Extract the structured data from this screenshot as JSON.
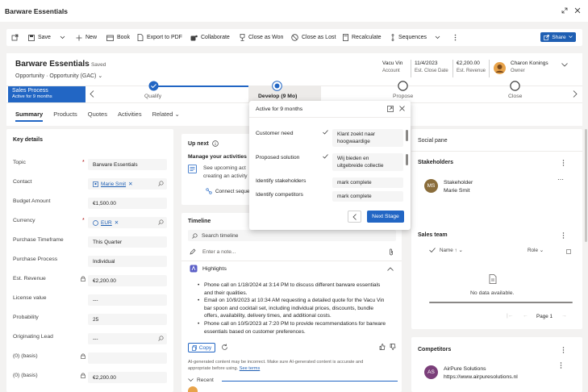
{
  "dialog": {
    "title": "Barware Essentials"
  },
  "toolbar": {
    "save": "Save",
    "new": "New",
    "book": "Book",
    "export_pdf": "Export to PDF",
    "collaborate": "Collaborate",
    "close_won": "Close as Won",
    "close_lost": "Close as Lost",
    "recalculate": "Recalculate",
    "sequences": "Sequences",
    "share": "Share"
  },
  "header": {
    "title": "Barware Essentials",
    "saved": "- Saved",
    "entity": "Opportunity",
    "form": "Opportunity (GAC)",
    "account_value": "Vacu Vin",
    "account_label": "Account",
    "close_date_value": "11/4/2023",
    "close_date_label": "Est. Close Date",
    "revenue_value": "€2,200.00",
    "revenue_label": "Est. Revenue",
    "owner_value": "Charon Konings",
    "owner_label": "Owner"
  },
  "bpf": {
    "process_name": "Sales Process",
    "process_status": "Active for 9 months",
    "stages": [
      {
        "label": "Qualify"
      },
      {
        "label": "Develop",
        "extra": "(9 Mo)"
      },
      {
        "label": "Propose"
      },
      {
        "label": "Close"
      }
    ]
  },
  "tabs": [
    "Summary",
    "Products",
    "Quotes",
    "Activities",
    "Related"
  ],
  "key_details": {
    "title": "Key details",
    "fields": [
      {
        "label": "Topic",
        "value": "Barware Essentials"
      },
      {
        "label": "Contact",
        "value": "Marie Smit"
      },
      {
        "label": "Budget Amount",
        "value": "€1,500.00"
      },
      {
        "label": "Currency",
        "value": "EUR"
      },
      {
        "label": "Purchase Timeframe",
        "value": "This Quarter"
      },
      {
        "label": "Purchase Process",
        "value": "Individual"
      },
      {
        "label": "Est. Revenue",
        "value": "€2,200.00"
      },
      {
        "label": "License value",
        "value": "---"
      },
      {
        "label": "Probability",
        "value": "25"
      },
      {
        "label": "Originating Lead",
        "value": "---"
      },
      {
        "label": "(0) (basis)",
        "value": ""
      },
      {
        "label": "(0) (basis)",
        "value": "€2,200.00"
      }
    ]
  },
  "upnext": {
    "title": "Up next",
    "manage": "Manage your activities",
    "desc1": "See upcoming act",
    "desc2": "creating an activity",
    "connect": "Connect seque"
  },
  "timeline": {
    "title": "Timeline",
    "search_placeholder": "Search timeline",
    "note_placeholder": "Enter a note...",
    "highlights": "Highlights",
    "bullets": [
      [
        "Phone call on 1/18/2024 at 3:14 PM to discuss different barware essentials",
        "and their qualities."
      ],
      [
        "Email on 10/9/2023 at 10:34 AM requesting a detailed quote for the Vacu Vin",
        "bar spoon and cocktail set, including individual prices, discounts, bundle",
        "offers, availability, delivery times, and additional costs."
      ],
      [
        "Phone call on 10/5/2023 at 7:20 PM to provide recommendations for barware",
        "essentials based on customer preferences."
      ]
    ],
    "copy": "Copy",
    "disclaimer1": "AI-generated content may be incorrect. Make sure AI-generated content is accurate and",
    "disclaimer2": "appropriate before using.",
    "see_terms": "See terms",
    "recent": "Recent"
  },
  "flyout": {
    "status": "Active for 9 months",
    "steps": [
      {
        "label": "Customer need",
        "value1": "Klant zoekt naar",
        "value2": "hoogwaardige"
      },
      {
        "label": "Proposed solution",
        "value1": "Wij bieden en",
        "value2": "uitgebreide collectie"
      },
      {
        "label": "Identify stakeholders",
        "value1": "mark complete",
        "value2": ""
      },
      {
        "label": "Identify competitors",
        "value1": "mark complete",
        "value2": ""
      }
    ],
    "next_stage": "Next Stage"
  },
  "social": {
    "title": "Social pane",
    "stakeholders_title": "Stakeholders",
    "stakeholder_initials": "MS",
    "stakeholder_role": "Stakeholder",
    "stakeholder_name": "Marie Smit",
    "sales_team_title": "Sales team",
    "col_name": "Name",
    "col_role": "Role",
    "no_data": "No data available.",
    "page": "Page 1",
    "competitors_title": "Competitors",
    "competitor_initials": "AS",
    "competitor_name": "AirPure Solutions",
    "competitor_url": "https://www.airpuresolutions.nl"
  },
  "colors": {
    "accent": "#2266c4",
    "ms_avatar": "#8a6d3b",
    "as_avatar": "#7b3f7a"
  }
}
